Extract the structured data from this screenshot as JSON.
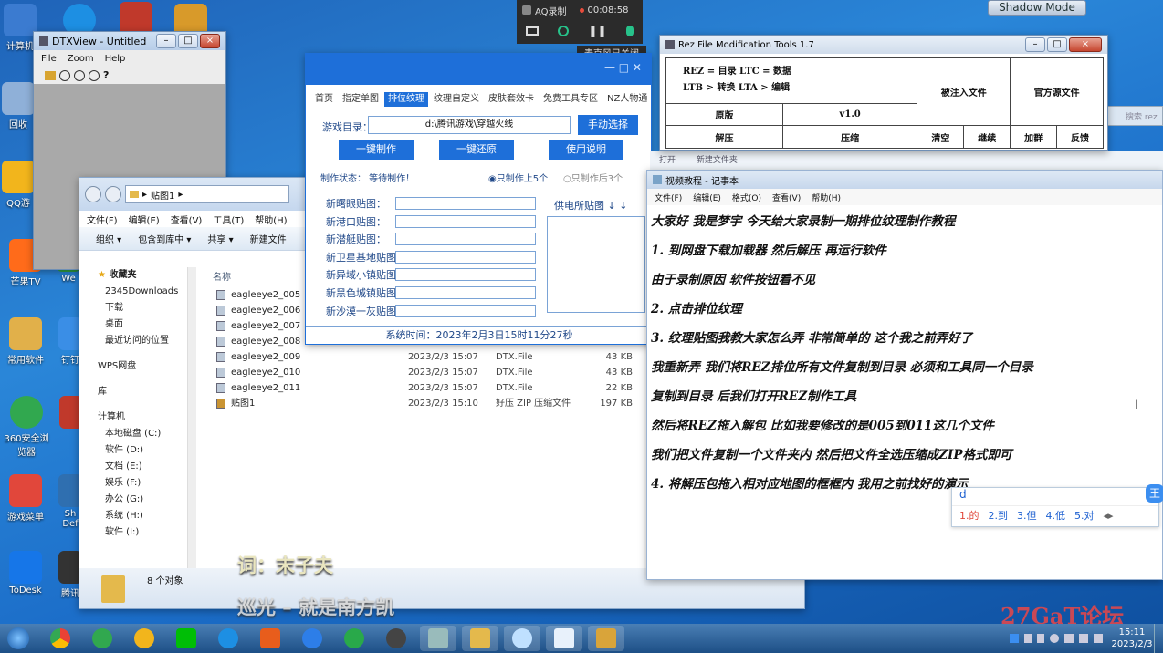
{
  "desktop": {
    "icons": [
      {
        "label": "计算机",
        "color": "#3b7bd0"
      },
      {
        "label": "",
        "color": "#1d8fe3"
      },
      {
        "label": "",
        "color": "#c0392b"
      },
      {
        "label": "",
        "color": "#d89a2a"
      },
      {
        "label": "回收",
        "color": "#8fb0d8"
      },
      {
        "label": "QQ游",
        "color": "#f2b51c"
      },
      {
        "label": "芒果TV",
        "color": "#ff6b1a"
      },
      {
        "label": "We",
        "color": "#2f9e44"
      },
      {
        "label": "常用软件",
        "color": "#e1b04a"
      },
      {
        "label": "钉钉",
        "color": "#3a8ee6"
      },
      {
        "label": "360安全浏览器",
        "color": "#31a84f"
      },
      {
        "label": "",
        "color": "#c0392b"
      },
      {
        "label": "游戏菜单",
        "color": "#e1473b"
      },
      {
        "label": "Sh Def",
        "color": "#2f6fb0"
      },
      {
        "label": "ToDesk",
        "color": "#1676e8"
      },
      {
        "label": "腾讯",
        "color": "#333"
      }
    ]
  },
  "shadow_mode": "Shadow Mode",
  "recorder": {
    "label": "AQ录制",
    "time": "00:08:58",
    "mic_tooltip": "麦克风已关闭"
  },
  "dtxview": {
    "title": "DTXView - Untitled",
    "menu": [
      "File",
      "Zoom",
      "Help"
    ]
  },
  "rez": {
    "title": "Rez File Modification Tools 1.7",
    "map1": "REZ = 目录  LTC = 数据",
    "map2": "LTB > 转换  LTA > 编辑",
    "injected": "被注入文件",
    "source": "官方源文件",
    "version_label": "原版",
    "version": "v1.0",
    "buttons": [
      "解压",
      "压缩",
      "清空",
      "继续",
      "加群",
      "反馈"
    ]
  },
  "behind_search": "搜索 rez",
  "behind_open": "打开",
  "behind_newfolder": "新建文件夹",
  "tool": {
    "tabs": [
      "首页",
      "指定单图",
      "排位纹理",
      "纹理自定义",
      "皮肤套效卡",
      "免费工具专区",
      "NZ人物通"
    ],
    "game_dir_label": "游戏目录：",
    "game_dir_value": "d:\\腾讯游戏\\穿越火线",
    "manual_select": "手动选择",
    "one_click_make": "一键制作",
    "one_click_restore": "一键还原",
    "instructions": "使用说明",
    "status": "制作状态：  等待制作！",
    "radio1": "只制作上5个",
    "radio2": "只制作后3个",
    "maps": [
      "新曙眼贴图：",
      "新港口贴图：",
      "新潜艇贴图：",
      "新卫星基地贴图：",
      "新异域小镇贴图：",
      "新黑色城镇贴图：",
      "新沙漠一灰贴图："
    ],
    "power_label": "供电所贴图 ↓ ↓",
    "sys_time": "系统时间：2023年2月3日15时11分27秒"
  },
  "explorer": {
    "path": "贴图1",
    "menu": [
      "文件(F)",
      "编辑(E)",
      "查看(V)",
      "工具(T)",
      "帮助(H)"
    ],
    "toolbar": [
      "组织 ▾",
      "包含到库中 ▾",
      "共享 ▾",
      "新建文件"
    ],
    "sidebar": [
      "收藏夹",
      "2345Downloads",
      "下载",
      "桌面",
      "最近访问的位置",
      "WPS网盘",
      "库",
      "计算机",
      "本地磁盘 (C:)",
      "软件 (D:)",
      "文档 (E:)",
      "娱乐 (F:)",
      "办公 (G:)",
      "系统 (H:)",
      "软件 (I:)"
    ],
    "col_name": "名称",
    "files": [
      {
        "name": "eagleeye2_005",
        "date": "",
        "type": "",
        "size": ""
      },
      {
        "name": "eagleeye2_006",
        "date": "",
        "type": "",
        "size": ""
      },
      {
        "name": "eagleeye2_007",
        "date": "",
        "type": "",
        "size": ""
      },
      {
        "name": "eagleeye2_008",
        "date": "",
        "type": "",
        "size": ""
      },
      {
        "name": "eagleeye2_009",
        "date": "2023/2/3 15:07",
        "type": "DTX.File",
        "size": "43 KB"
      },
      {
        "name": "eagleeye2_010",
        "date": "2023/2/3 15:07",
        "type": "DTX.File",
        "size": "43 KB"
      },
      {
        "name": "eagleeye2_011",
        "date": "2023/2/3 15:07",
        "type": "DTX.File",
        "size": "22 KB"
      },
      {
        "name": "贴图1",
        "date": "2023/2/3 15:10",
        "type": "好压 ZIP 压缩文件",
        "size": "197 KB"
      }
    ],
    "count": "8 个对象"
  },
  "notepad": {
    "title": "视频教程 - 记事本",
    "menu": [
      "文件(F)",
      "编辑(E)",
      "格式(O)",
      "查看(V)",
      "帮助(H)"
    ],
    "lines": [
      "大家好 我是梦宇 今天给大家录制一期排位纹理制作教程",
      "1. 到网盘下载加载器 然后解压 再运行软件",
      "由于录制原因 软件按钮看不见",
      "2. 点击排位纹理",
      "3. 纹理贴图我教大家怎么弄 非常简单的 这个我之前弄好了",
      "我重新弄 我们将REZ排位所有文件复制到目录 必须和工具同一个目录",
      "复制到目录 后我们打开REZ制作工具",
      "然后将REZ拖入解包 比如我要修改的是005到011这几个文件",
      "我们把文件复制一个文件夹内 然后把文件全选压缩成ZIP格式即可",
      "4. 将解压包拖入相对应地图的框框内 我用之前找好的演示"
    ]
  },
  "ime": {
    "input": "d",
    "candidates": [
      "1.的",
      "2.到",
      "3.但",
      "4.低",
      "5.对"
    ],
    "logo": "王"
  },
  "lyrics": {
    "line1": "词：末子夫",
    "line2": "巡光 – 就是南方凯"
  },
  "watermark": "27GaT论坛",
  "clock": {
    "time": "15:11",
    "date": "2023/2/3"
  }
}
